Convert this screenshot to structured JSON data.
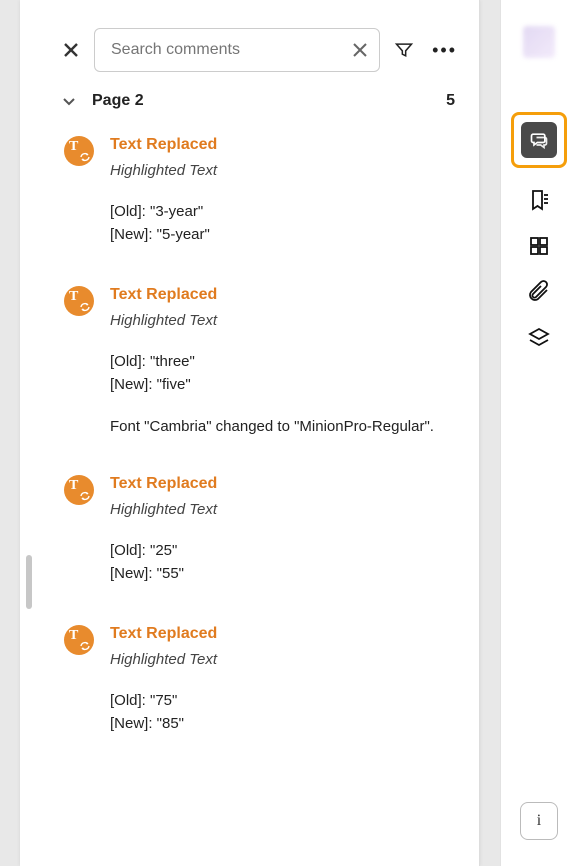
{
  "search": {
    "placeholder": "Search comments",
    "value": ""
  },
  "page": {
    "label": "Page 2",
    "count": "5"
  },
  "comments": [
    {
      "title": "Text Replaced",
      "subtitle": "Highlighted Text",
      "old": "[Old]: \"3-year\"",
      "new": "[New]: \"5-year\"",
      "extra": ""
    },
    {
      "title": "Text Replaced",
      "subtitle": "Highlighted Text",
      "old": "[Old]: \"three\"",
      "new": "[New]: \"five\"",
      "extra": "Font \"Cambria\" changed to \"MinionPro-Regular\"."
    },
    {
      "title": "Text Replaced",
      "subtitle": "Highlighted Text",
      "old": "[Old]: \"25\"",
      "new": "[New]: \"55\"",
      "extra": ""
    },
    {
      "title": "Text Replaced",
      "subtitle": "Highlighted Text",
      "old": "[Old]: \"75\"",
      "new": "[New]: \"85\"",
      "extra": ""
    }
  ],
  "info_button": "i",
  "colors": {
    "accent": "#e07b1f",
    "highlight": "#f59e0b"
  }
}
